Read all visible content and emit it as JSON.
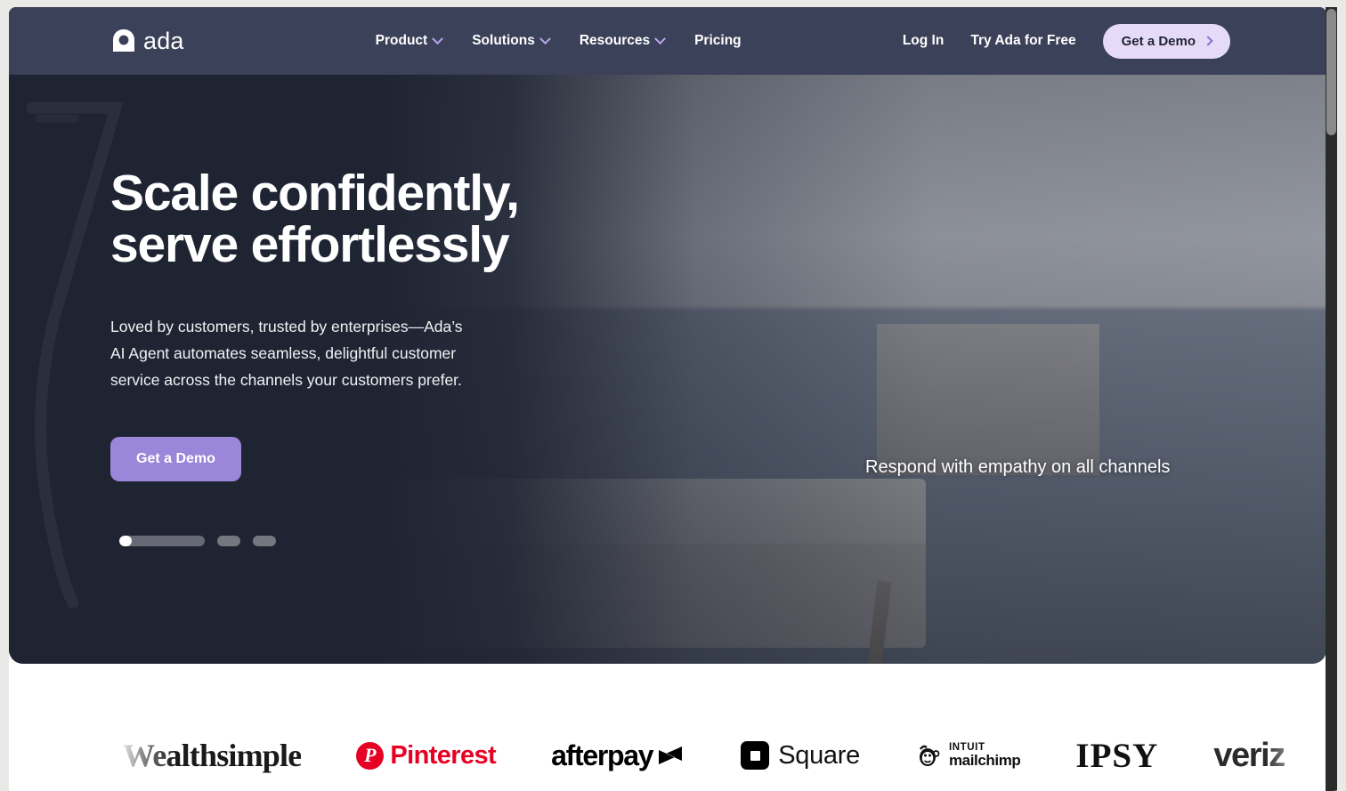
{
  "navbar": {
    "logo_text": "ada",
    "logo_icon": "ada-logo-icon",
    "menu": [
      {
        "label": "Product",
        "has_chevron": true
      },
      {
        "label": "Solutions",
        "has_chevron": true
      },
      {
        "label": "Resources",
        "has_chevron": true
      },
      {
        "label": "Pricing",
        "has_chevron": false
      }
    ],
    "login_label": "Log In",
    "try_free_label": "Try Ada for Free",
    "demo_button_label": "Get a Demo"
  },
  "hero": {
    "title": "Scale confidently,\nserve effortlessly",
    "subtitle": "Loved by customers, trusted by enterprises—Ada’s\nAI Agent automates seamless, delightful customer\nservice across the channels your customers prefer.",
    "cta_label": "Get a Demo",
    "caption": "Respond with empathy on all channels",
    "carousel": {
      "active_index": 0,
      "total": 3
    }
  },
  "logo_strip": {
    "brands": [
      {
        "name": "Wealthsimple",
        "text": "Wealthsimple"
      },
      {
        "name": "Pinterest",
        "text": "Pinterest",
        "mark": "P"
      },
      {
        "name": "Afterpay",
        "text": "afterpay"
      },
      {
        "name": "Square",
        "text": "Square"
      },
      {
        "name": "Intuit Mailchimp",
        "line1": "INTUIT",
        "line2": "mailchimp"
      },
      {
        "name": "IPSY",
        "text": "IPSY"
      },
      {
        "name": "Verizon",
        "text": "veriz"
      }
    ]
  },
  "colors": {
    "navbar_bg": "#3b4158",
    "hero_bg": "#1f2433",
    "accent_purple": "#9b86d9",
    "pill_lavender": "#e6daf9",
    "chevron_purple": "#b9a6ef",
    "pinterest_red": "#e60023"
  }
}
